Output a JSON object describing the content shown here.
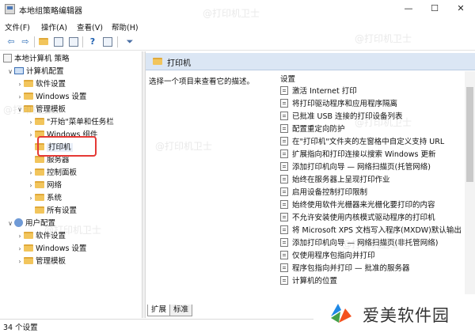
{
  "window": {
    "title": "本地组策略编辑器",
    "minimize": "—",
    "maximize": "☐",
    "close": "✕"
  },
  "menu": [
    "文件(F)",
    "操作(A)",
    "查看(V)",
    "帮助(H)"
  ],
  "toolbar": {
    "icons": [
      "back-icon",
      "forward-icon",
      "up-folder-icon",
      "show-hide-tree-icon",
      "export-list-icon",
      "help-icon",
      "properties-icon",
      "filter-icon"
    ]
  },
  "tree": {
    "items": [
      {
        "label": "本地计算机 策略",
        "icon": "policy-icon",
        "chevron": ""
      },
      {
        "label": "计算机配置",
        "icon": "computer-icon",
        "chevron": "∨"
      },
      {
        "label": "软件设置",
        "icon": "folder-icon",
        "chevron": "›"
      },
      {
        "label": "Windows 设置",
        "icon": "folder-icon",
        "chevron": "›"
      },
      {
        "label": "管理模板",
        "icon": "folder-icon",
        "chevron": "∨"
      },
      {
        "label": "\"开始\"菜单和任务栏",
        "icon": "folder-icon",
        "chevron": "›"
      },
      {
        "label": "Windows 组件",
        "icon": "folder-icon",
        "chevron": "›"
      },
      {
        "label": "打印机",
        "icon": "folder-icon",
        "chevron": ""
      },
      {
        "label": "服务器",
        "icon": "folder-icon",
        "chevron": ""
      },
      {
        "label": "控制面板",
        "icon": "folder-icon",
        "chevron": "›"
      },
      {
        "label": "网络",
        "icon": "folder-icon",
        "chevron": "›"
      },
      {
        "label": "系统",
        "icon": "folder-icon",
        "chevron": "›"
      },
      {
        "label": "所有设置",
        "icon": "folder-icon",
        "chevron": ""
      },
      {
        "label": "用户配置",
        "icon": "user-icon",
        "chevron": "∨"
      },
      {
        "label": "软件设置",
        "icon": "folder-icon",
        "chevron": "›"
      },
      {
        "label": "Windows 设置",
        "icon": "folder-icon",
        "chevron": "›"
      },
      {
        "label": "管理模板",
        "icon": "folder-icon",
        "chevron": "›"
      }
    ]
  },
  "pane": {
    "title": "打印机",
    "description": "选择一个项目来查看它的描述。",
    "settings_header": "设置",
    "settings": [
      "激活 Internet 打印",
      "将打印驱动程序和应用程序隔离",
      "已批准 USB 连接的打印设备列表",
      "配置重定向防护",
      "在\"打印机\"文件夹的左窗格中自定义支持 URL",
      "扩展指向和打印连接以搜索 Windows 更新",
      "添加打印机向导 — 网络扫描页(托管网络)",
      "始终在服务器上呈现打印作业",
      "启用设备控制打印限制",
      "始终使用软件光栅器来光栅化要打印的内容",
      "不允许安装使用内核模式驱动程序的打印机",
      "将 Microsoft XPS 文档写入程序(MXDW)默认输出",
      "添加打印机向导 — 网络扫描页(非托管网络)",
      "仅使用程序包指向并打印",
      "程序包指向并打印 — 批准的服务器",
      "计算机的位置"
    ]
  },
  "tabs": [
    "扩展",
    "标准"
  ],
  "status": "34 个设置",
  "brand": {
    "name": "爱美软件园"
  },
  "watermark": "@打印机卫士",
  "colors": {
    "header_band": "#dbe6f4",
    "highlight": "#e53935",
    "folder": "#f2c55c"
  }
}
